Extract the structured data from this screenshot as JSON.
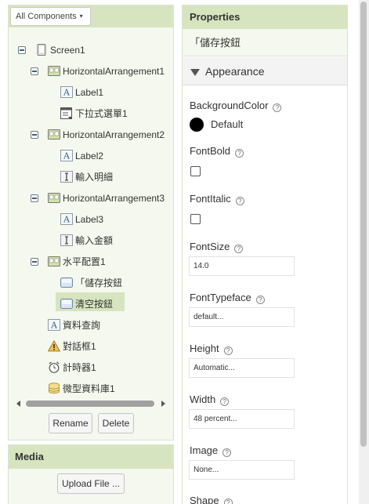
{
  "components_panel": {
    "dropdown_label": "All Components",
    "tree": [
      {
        "label": "Screen1",
        "icon": "screen-icon",
        "toggle": true
      },
      {
        "label": "HorizontalArrangement1",
        "icon": "arrangement-icon",
        "toggle": true
      },
      {
        "label": "Label1",
        "icon": "label-icon",
        "toggle": false
      },
      {
        "label": "下拉式選單1",
        "icon": "spinner-icon",
        "toggle": false
      },
      {
        "label": "HorizontalArrangement2",
        "icon": "arrangement-icon",
        "toggle": true
      },
      {
        "label": "Label2",
        "icon": "label-icon",
        "toggle": false
      },
      {
        "label": "輸入明細",
        "icon": "textbox-icon",
        "toggle": false
      },
      {
        "label": "HorizontalArrangement3",
        "icon": "arrangement-icon",
        "toggle": true
      },
      {
        "label": "Label3",
        "icon": "label-icon",
        "toggle": false
      },
      {
        "label": "輸入金額",
        "icon": "textbox-icon",
        "toggle": false
      },
      {
        "label": "水平配置1",
        "icon": "arrangement-icon",
        "toggle": true
      },
      {
        "label": "「儲存按鈕",
        "icon": "button-icon",
        "toggle": false,
        "selected": true
      },
      {
        "label": "清空按鈕",
        "icon": "button-icon",
        "toggle": false
      },
      {
        "label": "資料查詢",
        "icon": "label-icon",
        "toggle": false
      },
      {
        "label": "對話框1",
        "icon": "notifier-icon",
        "toggle": false
      },
      {
        "label": "計時器1",
        "icon": "clock-icon",
        "toggle": false
      },
      {
        "label": "微型資料庫1",
        "icon": "tinydb-icon",
        "toggle": false
      }
    ],
    "rename_label": "Rename",
    "delete_label": "Delete"
  },
  "media_panel": {
    "title": "Media",
    "upload_label": "Upload File ..."
  },
  "properties_panel": {
    "title": "Properties",
    "component_name": "「儲存按鈕",
    "section": "Appearance",
    "background_color": {
      "name": "BackgroundColor",
      "value": "Default",
      "swatch": "#000000"
    },
    "font_bold": {
      "name": "FontBold",
      "checked": false
    },
    "font_italic": {
      "name": "FontItalic",
      "checked": false
    },
    "font_size": {
      "name": "FontSize",
      "value": "14.0"
    },
    "font_typeface": {
      "name": "FontTypeface",
      "value": "default..."
    },
    "height": {
      "name": "Height",
      "value": "Automatic..."
    },
    "width": {
      "name": "Width",
      "value": "48 percent..."
    },
    "image": {
      "name": "Image",
      "value": "None..."
    },
    "shape": {
      "name": "Shape"
    },
    "help_glyph": "?"
  },
  "colors": {
    "panel_header": "#d6e5bf",
    "panel_bg": "#f5f8ee",
    "selection": "#d6e5bf"
  }
}
